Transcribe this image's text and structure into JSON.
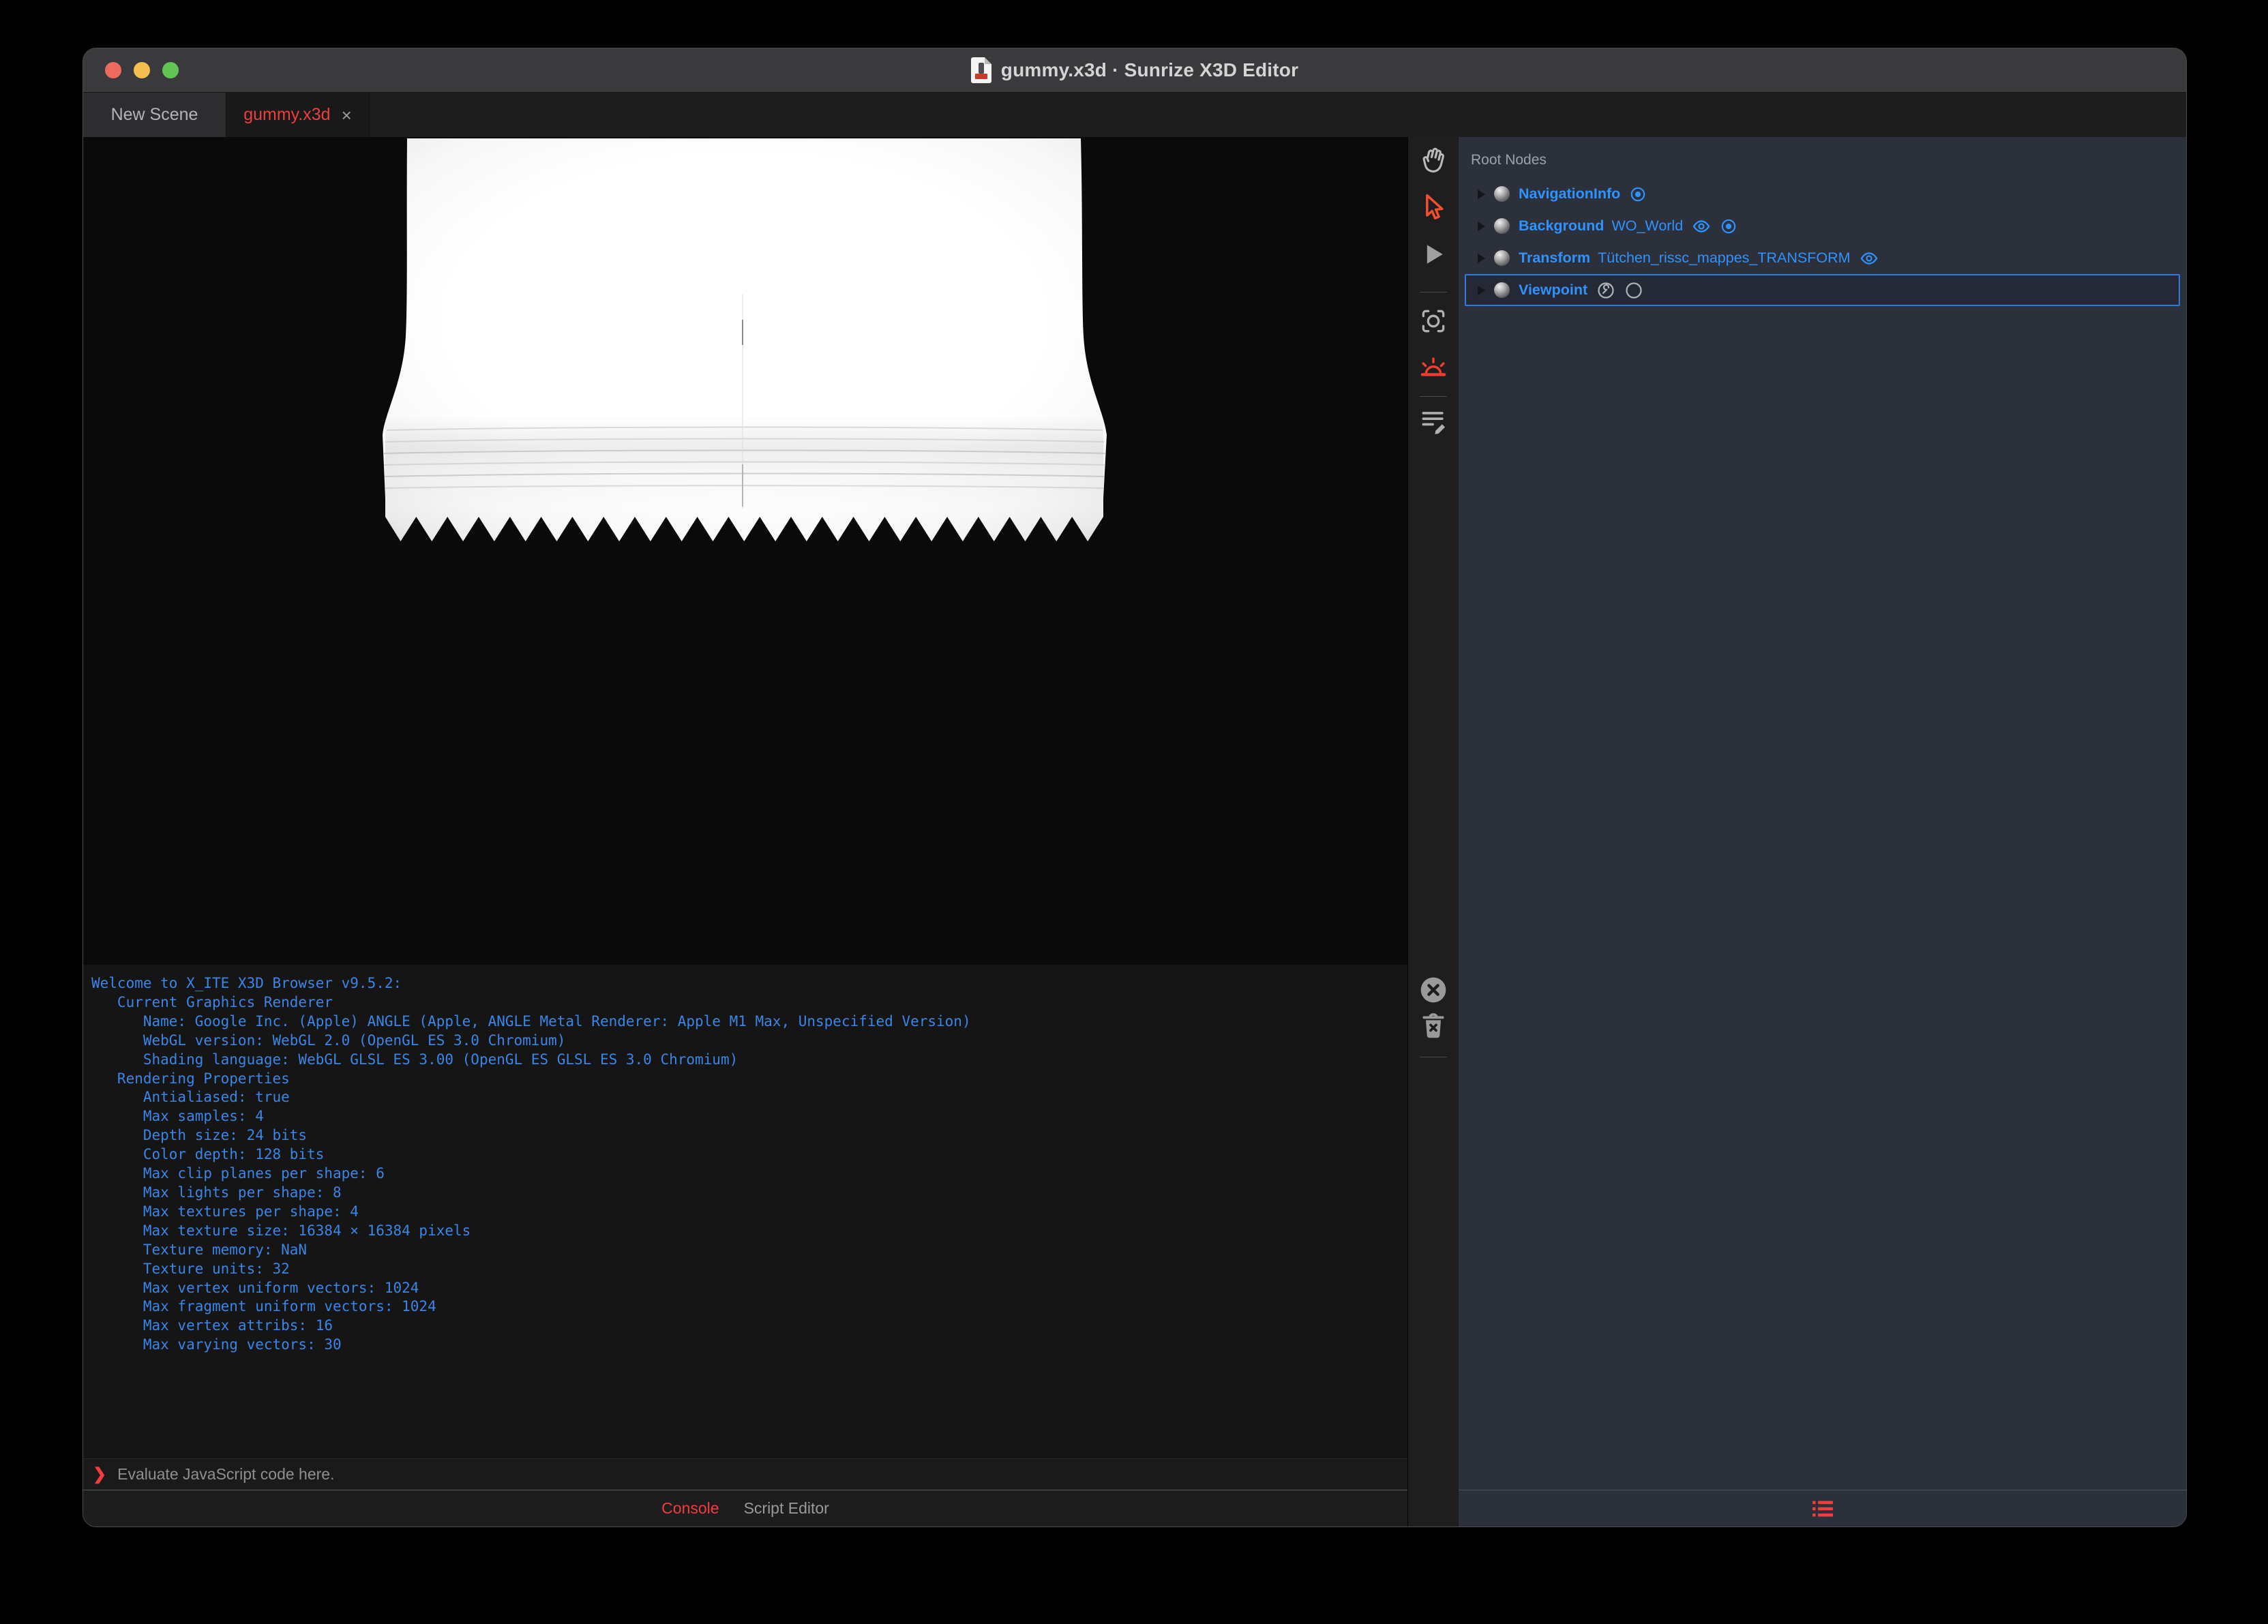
{
  "window": {
    "title": "gummy.x3d · Sunrize X3D Editor"
  },
  "tabs": [
    {
      "label": "New Scene",
      "active": false
    },
    {
      "label": "gummy.x3d",
      "active": true,
      "close": "×"
    }
  ],
  "toolbar": {
    "icons": [
      "pan-hand",
      "select-arrow",
      "play",
      "snapshot",
      "sunrise-light",
      "script-edit"
    ],
    "console_icons": [
      "clear-console",
      "delete-trash"
    ]
  },
  "outline": {
    "header": "Root Nodes",
    "nodes": [
      {
        "type": "NavigationInfo",
        "def": "",
        "trailing_icons": [
          "bound-icon"
        ],
        "selected": false
      },
      {
        "type": "Background",
        "def": "WO_World",
        "trailing_icons": [
          "eye-icon",
          "bound-icon"
        ],
        "selected": false
      },
      {
        "type": "Transform",
        "def": "Tütchen_rissc_mappes_TRANSFORM",
        "trailing_icons": [
          "eye-icon"
        ],
        "selected": false
      },
      {
        "type": "Viewpoint",
        "def": "",
        "trailing_icons": [
          "tool-circle-icon",
          "empty-circle-icon"
        ],
        "selected": true
      }
    ]
  },
  "console": {
    "lines": [
      "Welcome to X_ITE X3D Browser v9.5.2:",
      "   Current Graphics Renderer",
      "      Name: Google Inc. (Apple) ANGLE (Apple, ANGLE Metal Renderer: Apple M1 Max, Unspecified Version)",
      "      WebGL version: WebGL 2.0 (OpenGL ES 3.0 Chromium)",
      "      Shading language: WebGL GLSL ES 3.00 (OpenGL ES GLSL ES 3.0 Chromium)",
      "   Rendering Properties",
      "      Antialiased: true",
      "      Max samples: 4",
      "      Depth size: 24 bits",
      "      Color depth: 128 bits",
      "      Max clip planes per shape: 6",
      "      Max lights per shape: 8",
      "      Max textures per shape: 4",
      "      Max texture size: 16384 × 16384 pixels",
      "      Texture memory: NaN",
      "      Texture units: 32",
      "      Max vertex uniform vectors: 1024",
      "      Max fragment uniform vectors: 1024",
      "      Max vertex attribs: 16",
      "      Max varying vectors: 30"
    ],
    "prompt": "❯",
    "input_placeholder": "Evaluate JavaScript code here."
  },
  "footer": {
    "tabs": [
      {
        "label": "Console",
        "active": true
      },
      {
        "label": "Script Editor",
        "active": false
      }
    ]
  },
  "colors": {
    "accent_red": "#f23d3d",
    "accent_blue": "#2f93ff",
    "console_text_blue": "#3a86e8",
    "selection_border": "#2d7de0",
    "panel_background": "#2b303a",
    "traffic_red": "#ec6a5e",
    "traffic_yellow": "#f5bf4f",
    "traffic_green": "#61c554"
  }
}
